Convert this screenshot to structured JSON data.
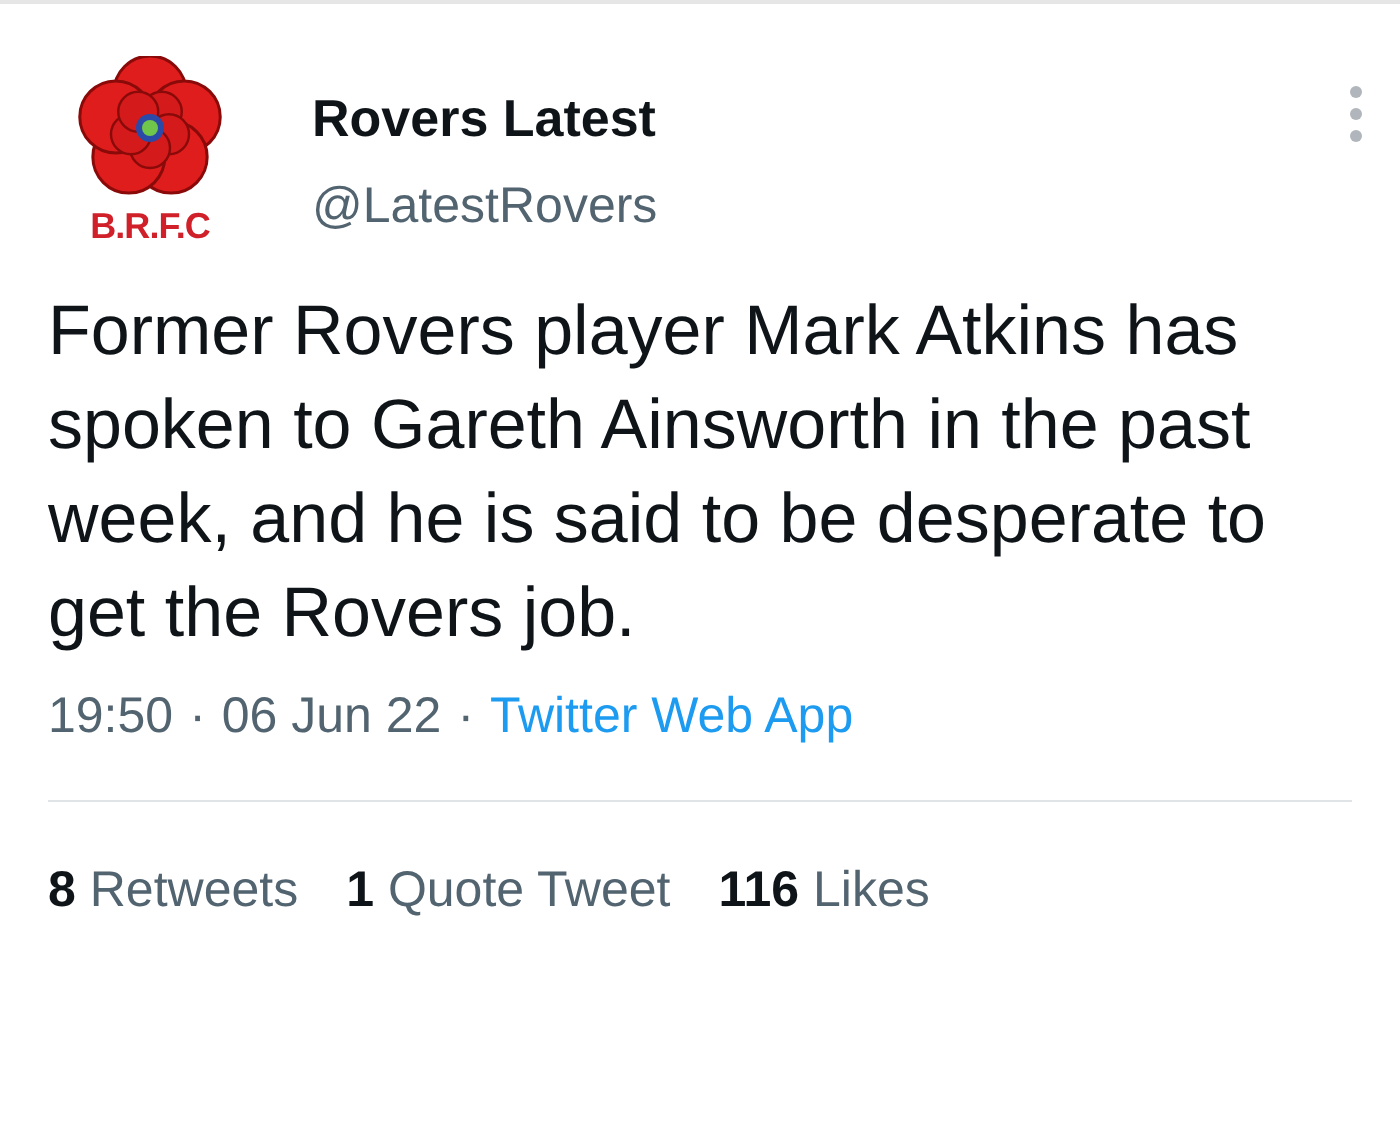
{
  "author": {
    "avatar_text": "B.R.F.C",
    "name": "Rovers Latest",
    "handle": "@LatestRovers"
  },
  "body": "Former Rovers player Mark Atkins has spoken to Gareth Ainsworth in the past week, and he is said to be desperate to get the Rovers job.",
  "meta": {
    "time": "19:50",
    "separator_1": "·",
    "date": "06 Jun 22",
    "separator_2": "·",
    "source": "Twitter Web App"
  },
  "stats": [
    {
      "count": "8",
      "label": "Retweets"
    },
    {
      "count": "1",
      "label": "Quote Tweet"
    },
    {
      "count": "116",
      "label": "Likes"
    }
  ]
}
